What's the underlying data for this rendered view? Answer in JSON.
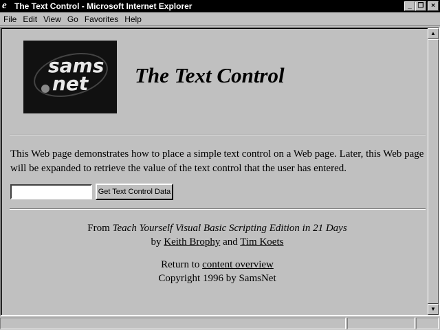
{
  "window": {
    "title": "The Text Control - Microsoft Internet Explorer",
    "minimize_label": "_",
    "restore_label": "❐",
    "close_label": "×"
  },
  "menu": [
    {
      "label": "File"
    },
    {
      "label": "Edit"
    },
    {
      "label": "View"
    },
    {
      "label": "Go"
    },
    {
      "label": "Favorites"
    },
    {
      "label": "Help"
    }
  ],
  "page": {
    "logo_text_1": "sams",
    "logo_text_2": "net",
    "title": "The Text Control",
    "description": "This Web page demonstrates how to place a simple text control on a Web page. Later, this Web page will be expanded to retrieve the value of the text control that the user has entered.",
    "text_input_value": "",
    "button_label": "Get Text Control Data",
    "credit_from": "From",
    "book_title": "Teach Yourself Visual Basic Scripting Edition in 21 Days",
    "credit_by": "by",
    "author1": "Keith Brophy",
    "credit_and": "and",
    "author2": "Tim Koets",
    "return_text": "Return to",
    "return_link": "content overview",
    "copyright": "Copyright 1996 by SamsNet"
  },
  "scrollbar": {
    "up_icon": "▲",
    "down_icon": "▼"
  },
  "icons": {
    "app": "ie-icon",
    "up": "scroll-up-icon",
    "down": "scroll-down-icon"
  }
}
